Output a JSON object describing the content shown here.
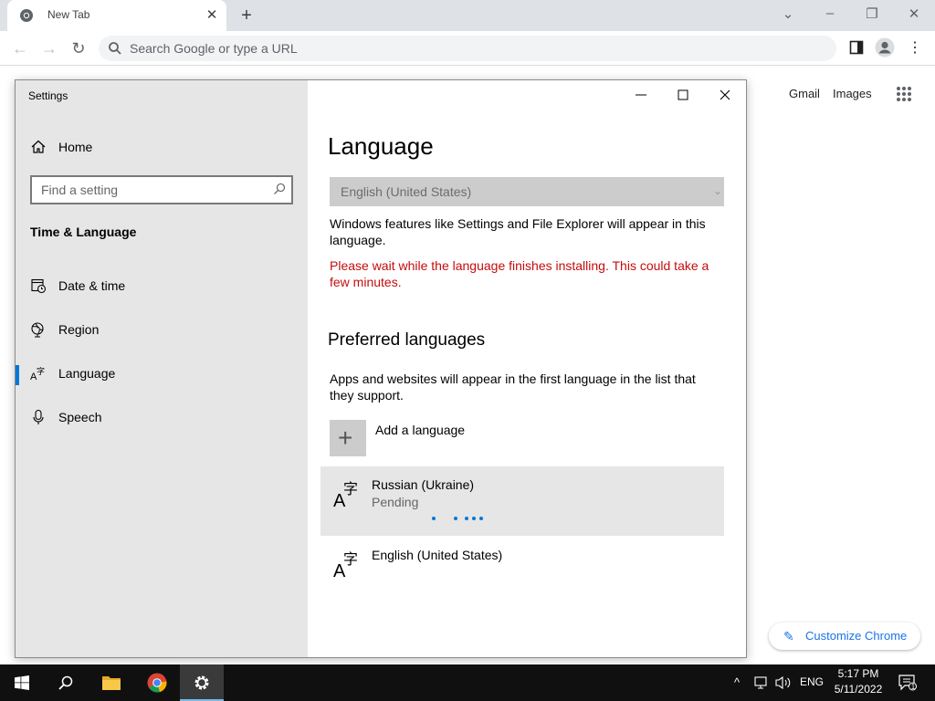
{
  "browser": {
    "tab_title": "New Tab",
    "tab_close_icon": "close-icon",
    "new_tab_icon": "plus-icon",
    "omnibox_placeholder": "Search Google or type a URL",
    "ntp_links": {
      "gmail": "Gmail",
      "images": "Images"
    },
    "customize_label": "Customize Chrome"
  },
  "settings": {
    "window_title": "Settings",
    "home_label": "Home",
    "search_placeholder": "Find a setting",
    "section_title": "Time & Language",
    "nav": [
      {
        "label": "Date & time",
        "icon": "calendar-clock-icon"
      },
      {
        "label": "Region",
        "icon": "globe-icon"
      },
      {
        "label": "Language",
        "icon": "language-icon",
        "selected": true
      },
      {
        "label": "Speech",
        "icon": "microphone-icon"
      }
    ],
    "page_title": "Language",
    "display_language": "English (United States)",
    "display_desc": "Windows features like Settings and File Explorer will appear in this language.",
    "warning": "Please wait while the language finishes installing. This could take a few minutes.",
    "preferred_title": "Preferred languages",
    "preferred_desc": "Apps and websites will appear in the first language in the list that they support.",
    "add_language": "Add a language",
    "languages": [
      {
        "name": "Russian (Ukraine)",
        "status": "Pending"
      },
      {
        "name": "English (United States)",
        "status": ""
      }
    ],
    "accent_color": "#0078d7",
    "warning_color": "#c40c0c"
  },
  "taskbar": {
    "language_indicator": "ENG",
    "time": "5:17 PM",
    "date": "5/11/2022",
    "notification_count": "1"
  }
}
